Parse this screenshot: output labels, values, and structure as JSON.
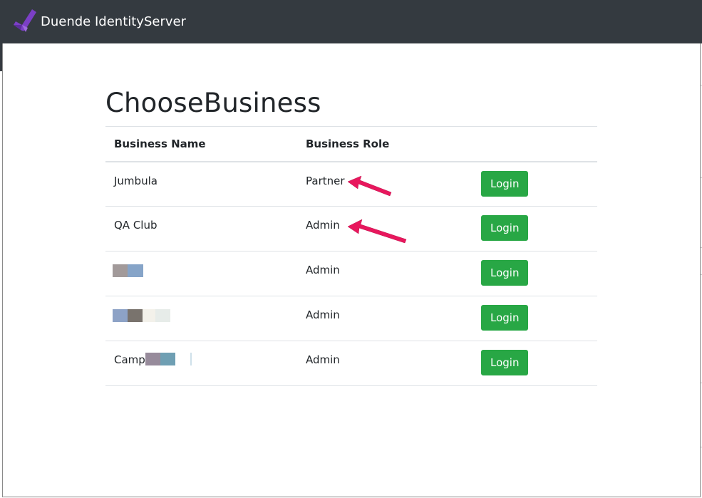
{
  "navbar": {
    "brand": "Duende IdentityServer",
    "logo_icon": "duende-logo-icon",
    "bg": "#343a40"
  },
  "page": {
    "title": "ChooseBusiness"
  },
  "table": {
    "headers": {
      "name": "Business Name",
      "role": "Business Role"
    },
    "rows": [
      {
        "name": "Jumbula",
        "role": "Partner",
        "action": "Login"
      },
      {
        "name": "QA Club",
        "role": "Admin",
        "action": "Login"
      },
      {
        "name": "",
        "role": "Admin",
        "action": "Login"
      },
      {
        "name": "",
        "role": "Admin",
        "action": "Login"
      },
      {
        "name": "Camp",
        "role": "Admin",
        "action": "Login"
      }
    ]
  },
  "colors": {
    "login_button": "#28a745",
    "annotation_arrow": "#e8175d"
  }
}
